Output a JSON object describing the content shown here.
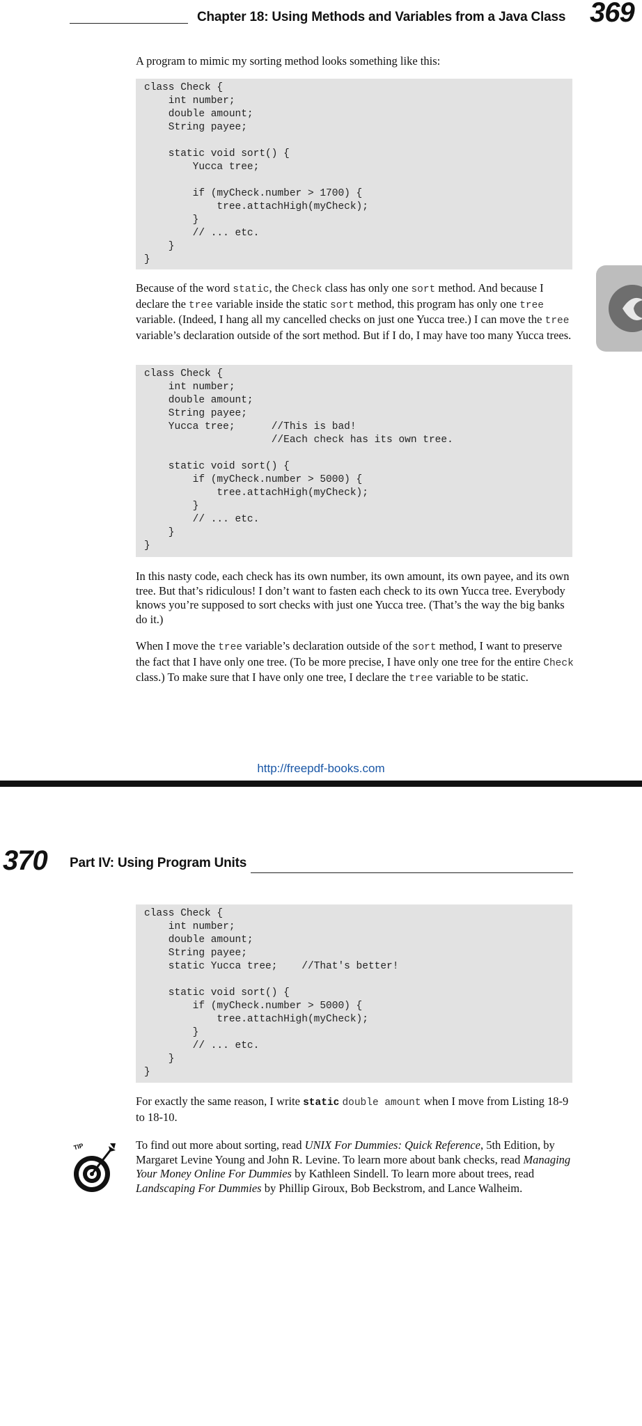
{
  "page_top": {
    "running_head": "Chapter 18: Using Methods and Variables from a Java Class",
    "page_number": "369",
    "intro_text": "A program to mimic my sorting method looks something like this:",
    "code_1": "class Check {\n    int number;\n    double amount;\n    String payee;\n\n    static void sort() {\n        Yucca tree;\n\n        if (myCheck.number > 1700) {\n            tree.attachHigh(myCheck);\n        }\n        // ... etc.\n    }\n}",
    "para_2": [
      {
        "t": "Because of the word "
      },
      {
        "c": "static"
      },
      {
        "t": ", the "
      },
      {
        "c": "Check"
      },
      {
        "t": " class has only one "
      },
      {
        "c": "sort"
      },
      {
        "t": " method. And because I declare the "
      },
      {
        "c": "tree"
      },
      {
        "t": " variable inside the static "
      },
      {
        "c": "sort"
      },
      {
        "t": " method, this program has only one "
      },
      {
        "c": "tree"
      },
      {
        "t": " variable. (Indeed, I hang all my cancelled checks on just one Yucca tree.) I can move the "
      },
      {
        "c": "tree"
      },
      {
        "t": " variable’s declaration outside of the sort method. But if I do, I may have too many Yucca trees."
      }
    ],
    "code_2": "class Check {\n    int number;\n    double amount;\n    String payee;\n    Yucca tree;      //This is bad!\n                     //Each check has its own tree.\n\n    static void sort() {\n        if (myCheck.number > 5000) {\n            tree.attachHigh(myCheck);\n        }\n        // ... etc.\n    }\n}",
    "para_3": "In this nasty code, each check has its own number, its own amount, its own payee, and its own tree. But that’s ridiculous! I don’t want to fasten each check to its own Yucca tree. Everybody knows you’re supposed to sort checks with just one Yucca tree. (That’s the way the big banks do it.)",
    "para_4": [
      {
        "t": "When I move the "
      },
      {
        "c": "tree"
      },
      {
        "t": " variable’s declaration outside of the "
      },
      {
        "c": "sort"
      },
      {
        "t": " method, I want to preserve the fact that I have only one tree. (To be more precise, I have only one tree for the entire "
      },
      {
        "c": "Check"
      },
      {
        "t": " class.) To make sure that I have only one tree, I declare the "
      },
      {
        "c": "tree"
      },
      {
        "t": " variable to be static."
      }
    ],
    "source_url": "http://freepdf-books.com"
  },
  "page_bottom": {
    "page_number": "370",
    "running_head": "Part IV: Using Program Units",
    "code_3": "class Check {\n    int number;\n    double amount;\n    String payee;\n    static Yucca tree;    //That's better!\n\n    static void sort() {\n        if (myCheck.number > 5000) {\n            tree.attachHigh(myCheck);\n        }\n        // ... etc.\n    }\n}",
    "para_5": [
      {
        "t": "For exactly the same reason, I write "
      },
      {
        "b": "static"
      },
      {
        "t": " "
      },
      {
        "c": "double amount"
      },
      {
        "t": " when I move from Listing 18-9 to 18-10."
      }
    ],
    "tip_label": "TIP",
    "tip_text": [
      {
        "t": "To find out more about sorting, read "
      },
      {
        "i": "UNIX For Dummies: Quick Reference"
      },
      {
        "t": ", 5th Edition, by Margaret Levine Young and John R. Levine. To learn more about bank checks, read "
      },
      {
        "i": "Managing Your Money Online For Dummies"
      },
      {
        "t": " by Kathleen Sindell. To learn more about trees, read "
      },
      {
        "i": "Landscaping For Dummies"
      },
      {
        "t": " by Phillip Giroux, Bob Beckstrom, and Lance Walheim."
      }
    ]
  }
}
